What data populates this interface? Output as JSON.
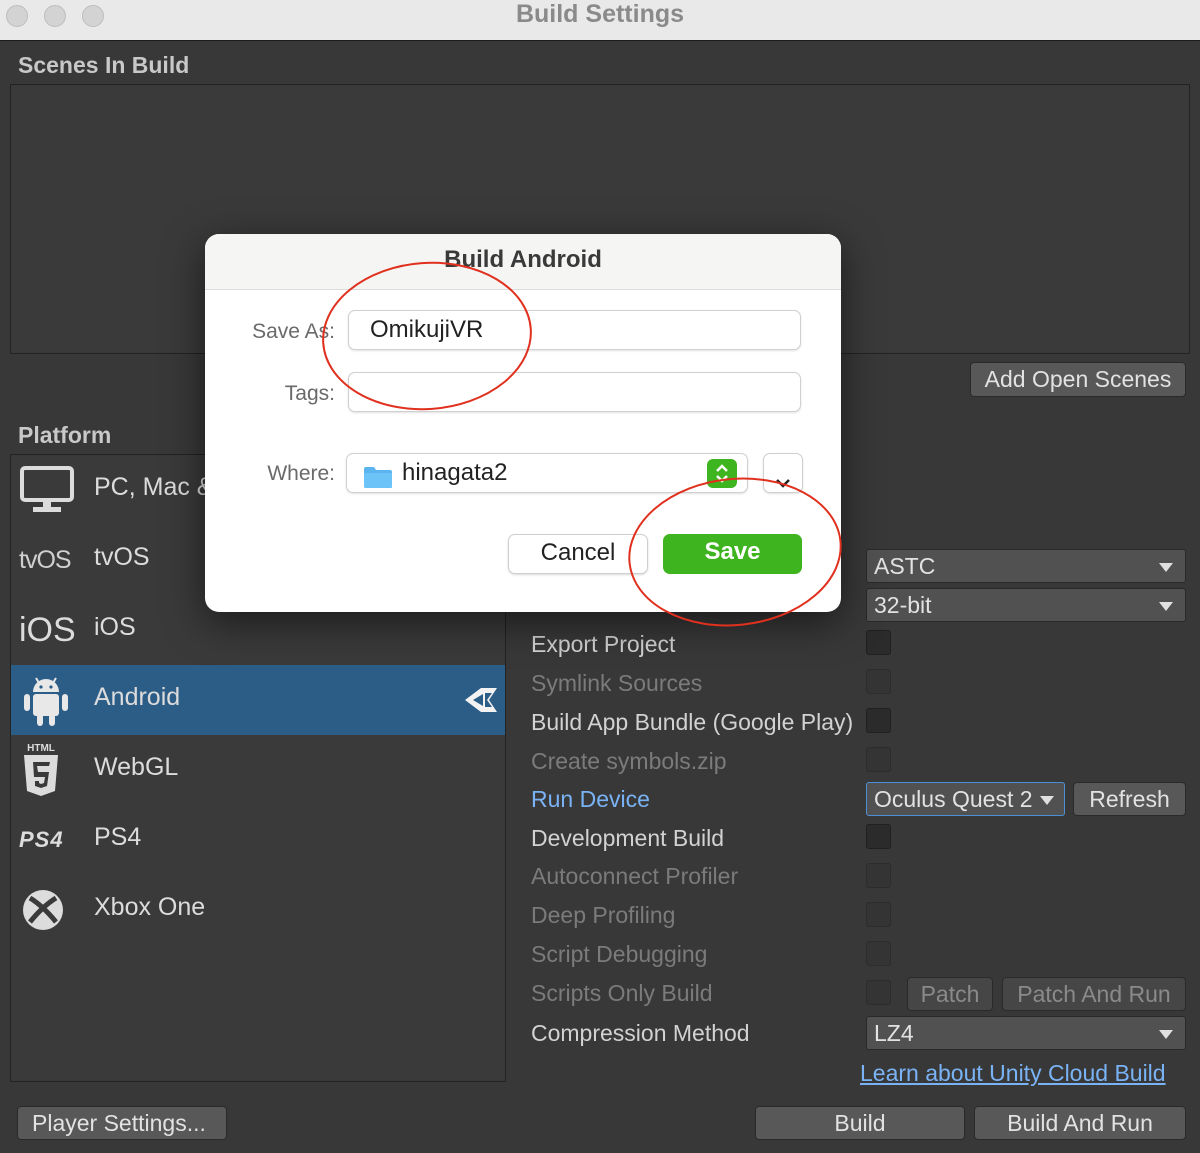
{
  "window": {
    "title": "Build Settings"
  },
  "scenes": {
    "heading": "Scenes In Build",
    "add_open_scenes_label": "Add Open Scenes"
  },
  "platform": {
    "heading": "Platform",
    "items": [
      {
        "label": "PC, Mac & Linux Standalone",
        "icon": "monitor-icon",
        "selected": false
      },
      {
        "label": "tvOS",
        "icon": "tvos-icon",
        "icon_text": "tvOS",
        "selected": false
      },
      {
        "label": "iOS",
        "icon": "ios-icon",
        "icon_text": "iOS",
        "selected": false
      },
      {
        "label": "Android",
        "icon": "android-icon",
        "selected": true
      },
      {
        "label": "WebGL",
        "icon": "html5-icon",
        "icon_text": "HTML",
        "selected": false
      },
      {
        "label": "PS4",
        "icon": "ps4-icon",
        "icon_text": "PS4",
        "selected": false
      },
      {
        "label": "Xbox One",
        "icon": "xbox-icon",
        "selected": false
      }
    ]
  },
  "android_settings": {
    "texture_compression": "ASTC",
    "etc2_fallback": "32-bit",
    "export_project": "Export Project",
    "symlink_sources": "Symlink Sources",
    "build_app_bundle": "Build App Bundle (Google Play)",
    "create_symbols": "Create symbols.zip",
    "run_device_label": "Run Device",
    "run_device_value": "Oculus Quest 2",
    "refresh_label": "Refresh",
    "development_build": "Development Build",
    "autoconnect_profiler": "Autoconnect Profiler",
    "deep_profiling": "Deep Profiling",
    "script_debugging": "Script Debugging",
    "scripts_only_build": "Scripts Only Build",
    "patch_label": "Patch",
    "patch_and_run_label": "Patch And Run",
    "compression_method_label": "Compression Method",
    "compression_method_value": "LZ4",
    "cloud_build_link": "Learn about Unity Cloud Build"
  },
  "footer": {
    "player_settings_label": "Player Settings...",
    "build_label": "Build",
    "build_and_run_label": "Build And Run"
  },
  "dialog": {
    "title": "Build Android",
    "save_as_label": "Save As:",
    "save_as_value": "OmikujiVR",
    "tags_label": "Tags:",
    "tags_value": "",
    "where_label": "Where:",
    "where_value": "hinagata2",
    "cancel_label": "Cancel",
    "save_label": "Save"
  },
  "colors": {
    "selected_platform": "#2c5d87",
    "save_button": "#3eb51e",
    "annotation": "#e0301e",
    "link": "#7ab3f5"
  }
}
